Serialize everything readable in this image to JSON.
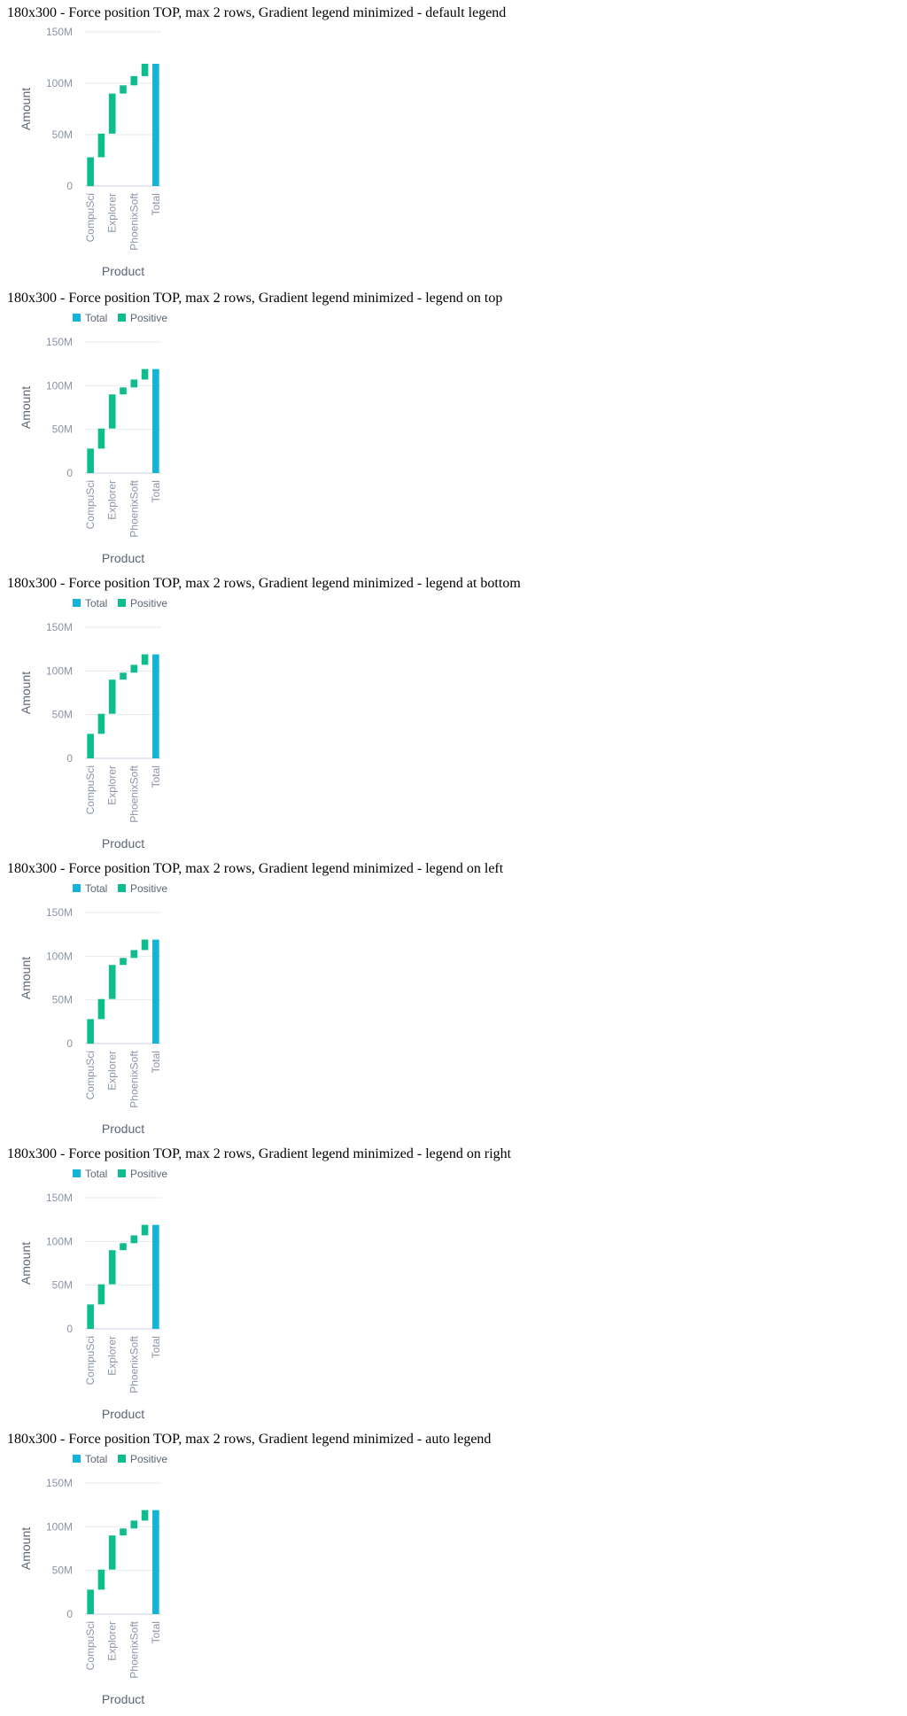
{
  "colors": {
    "total": "#14b4d6",
    "positive": "#0ebd8e",
    "grid": "#e6e9ef",
    "axis": "#c9d0e6"
  },
  "sections": [
    {
      "title": "180x300 - Force position TOP, max 2 rows, Gradient legend minimized - default legend",
      "show_legend": false
    },
    {
      "title": "180x300 - Force position TOP, max 2 rows, Gradient legend minimized - legend on top",
      "show_legend": true
    },
    {
      "title": "180x300 - Force position TOP, max 2 rows, Gradient legend minimized - legend at bottom",
      "show_legend": true
    },
    {
      "title": "180x300 - Force position TOP, max 2 rows, Gradient legend minimized - legend on left",
      "show_legend": true
    },
    {
      "title": "180x300 - Force position TOP, max 2 rows, Gradient legend minimized - legend on right",
      "show_legend": true
    },
    {
      "title": "180x300 - Force position TOP, max 2 rows, Gradient legend minimized - auto legend",
      "show_legend": true
    }
  ],
  "chart_data": {
    "type": "bar",
    "subtype": "waterfall",
    "categories": [
      "CompuSci",
      "",
      "Explorer",
      "",
      "PhoenixSoft",
      "",
      "Total"
    ],
    "bars": [
      {
        "category": "CompuSci",
        "start": 0,
        "end": 28000000,
        "kind": "Positive"
      },
      {
        "category": "",
        "start": 28000000,
        "end": 51000000,
        "kind": "Positive"
      },
      {
        "category": "Explorer",
        "start": 51000000,
        "end": 90000000,
        "kind": "Positive"
      },
      {
        "category": "",
        "start": 90000000,
        "end": 98000000,
        "kind": "Positive"
      },
      {
        "category": "PhoenixSoft",
        "start": 98000000,
        "end": 107000000,
        "kind": "Positive"
      },
      {
        "category": "",
        "start": 107000000,
        "end": 119000000,
        "kind": "Positive"
      },
      {
        "category": "Total",
        "start": 0,
        "end": 119000000,
        "kind": "Total"
      }
    ],
    "legend": [
      "Total",
      "Positive"
    ],
    "xlabel": "Product",
    "ylabel": "Amount",
    "ylim": [
      0,
      150000000
    ],
    "yticks": [
      0,
      50000000,
      100000000,
      150000000
    ],
    "ytick_labels": [
      "0",
      "50M",
      "100M",
      "150M"
    ],
    "grid": true
  }
}
